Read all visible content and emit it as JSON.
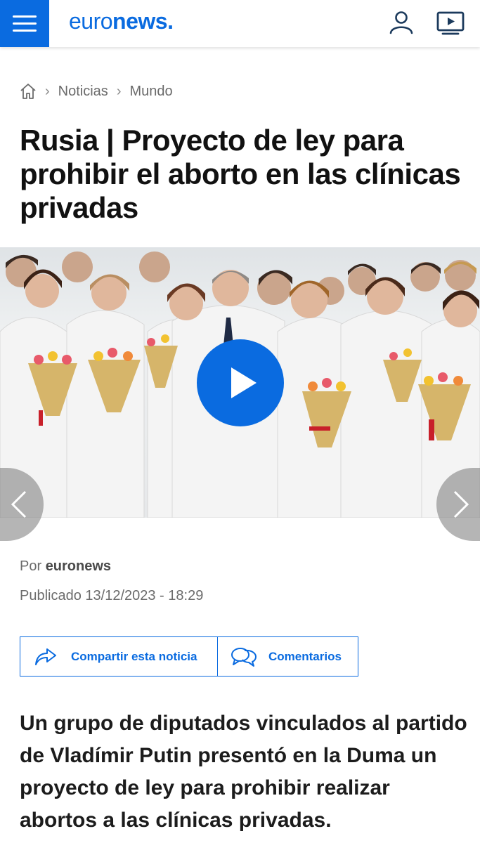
{
  "header": {
    "logo_part1": "euro",
    "logo_part2": "news",
    "logo_dot": ".",
    "menu_icon": "hamburger-menu-icon",
    "user_icon": "user-icon",
    "tv_icon": "tv-play-icon",
    "brand_color": "#0a6be0"
  },
  "breadcrumb": {
    "home_icon": "home-icon",
    "items": [
      "Noticias",
      "Mundo"
    ]
  },
  "article": {
    "title": "Rusia | Proyecto de ley para prohibir el aborto en las clínicas privadas",
    "byline_prefix": "Por",
    "byline_author": "euronews",
    "published": "Publicado 13/12/2023 - 18:29",
    "lead": "Un grupo de diputados vinculados al partido de Vladímir Putin presentó en la Duma un proyecto de ley para prohibir realizar abortos a las clínicas privadas."
  },
  "media": {
    "play_icon": "play-icon",
    "prev_icon": "chevron-left-icon",
    "next_icon": "chevron-right-icon"
  },
  "actions": {
    "share_label": "Compartir esta noticia",
    "share_icon": "share-arrow-icon",
    "comments_label": "Comentarios",
    "comments_icon": "comments-bubbles-icon"
  }
}
